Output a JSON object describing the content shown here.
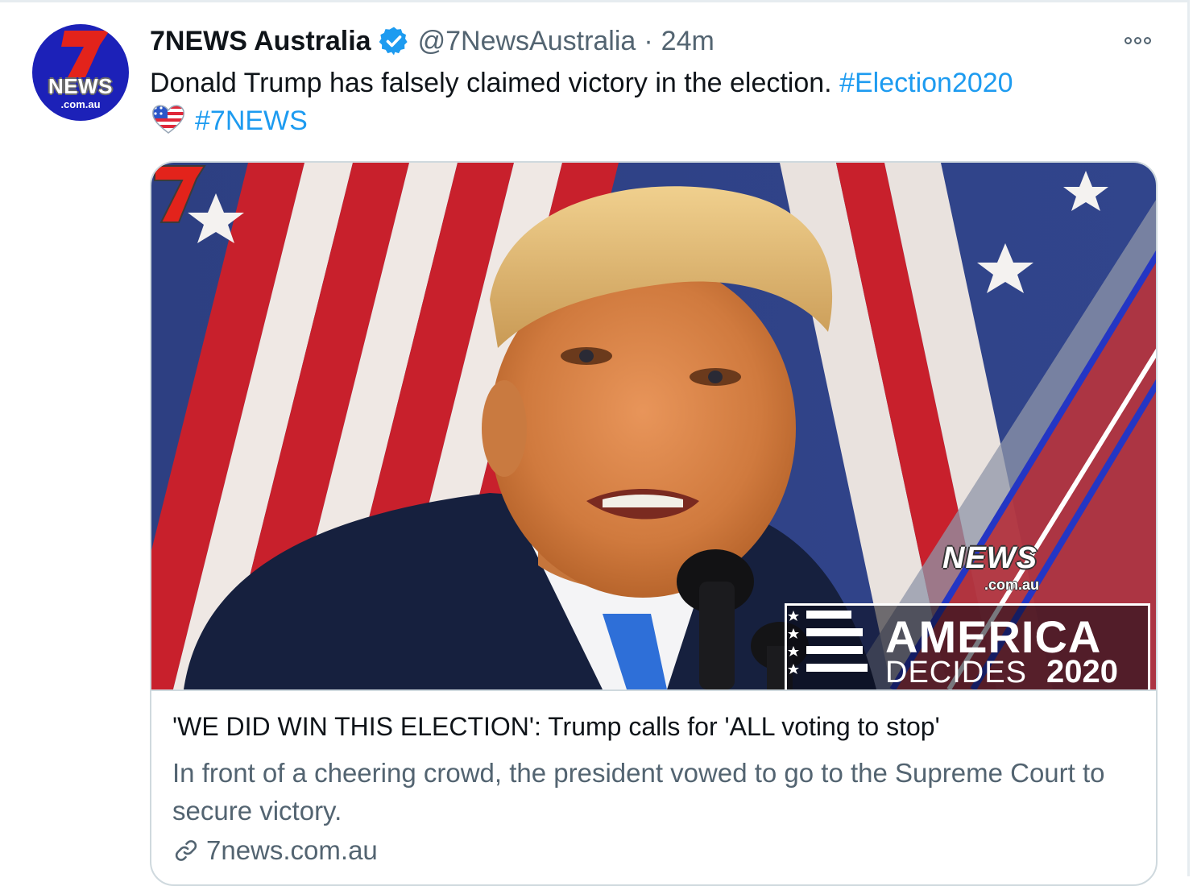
{
  "tweet": {
    "author": {
      "name": "7NEWS Australia",
      "handle": "@7NewsAustralia",
      "time": "24m",
      "separator": "·",
      "avatar": {
        "logo_text": "NEWS",
        "logo_domain": ".com.au"
      }
    },
    "text": {
      "body": "Donald Trump has falsely claimed victory in the election.",
      "hashtag_1": "#Election2020",
      "hashtag_2": "#7NEWS"
    },
    "card": {
      "image_overlay": {
        "logo_text": "NEWS",
        "logo_domain": ".com.au",
        "banner_line1": "AMERICA",
        "banner_line2": "DECIDES",
        "banner_year": "2020"
      },
      "title": "'WE DID WIN THIS ELECTION': Trump calls for 'ALL voting to stop'",
      "description": "In front of a cheering crowd, the president vowed to go to the Supreme Court to secure victory.",
      "domain": "7news.com.au"
    }
  },
  "icons": {
    "verified": "verified-badge-icon",
    "more": "more-options-icon",
    "link": "link-icon",
    "emoji": "us-flag-heart-emoji"
  },
  "colors": {
    "hashtag": "#1d9bf0",
    "secondary_text": "#536471",
    "verified": "#1d9bf0",
    "avatar_bg": "#1c21b8",
    "brand_red": "#e3231b"
  }
}
